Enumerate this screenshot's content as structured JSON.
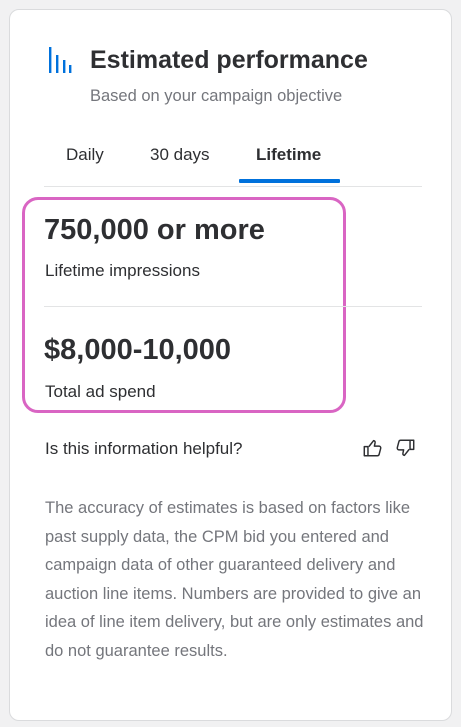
{
  "header": {
    "icon": "bar-chart-icon",
    "title": "Estimated performance",
    "subtitle": "Based on your campaign objective"
  },
  "tabs": [
    {
      "label": "Daily",
      "active": false
    },
    {
      "label": "30 days",
      "active": false
    },
    {
      "label": "Lifetime",
      "active": true
    }
  ],
  "stats": [
    {
      "value": "750,000 or more",
      "label": "Lifetime impressions"
    },
    {
      "value": "$8,000-10,000",
      "label": "Total ad spend"
    }
  ],
  "feedback": {
    "question": "Is this information helpful?",
    "icons": [
      "thumbs-up-icon",
      "thumbs-down-icon"
    ]
  },
  "disclaimer": "The accuracy of estimates is based on factors like past supply data, the CPM bid you entered and campaign data of other guaranteed delivery and auction line items. Numbers are provided to give an idea of line item delivery, but are only estimates and do not guarantee results.",
  "colors": {
    "accent": "#0071dc",
    "highlight_border": "#d965c3",
    "text_primary": "#2e2f32",
    "text_secondary": "#74767c"
  }
}
